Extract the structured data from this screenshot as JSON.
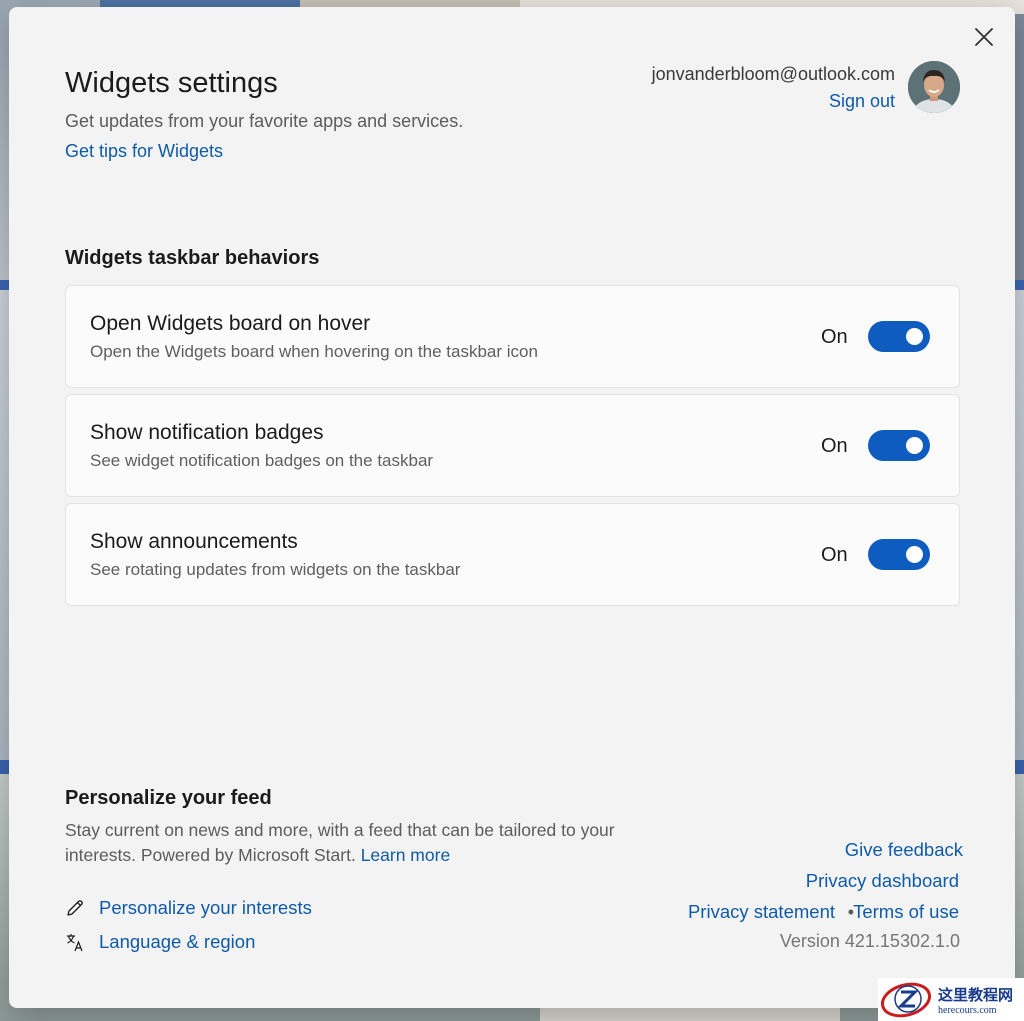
{
  "colors": {
    "accent": "#0e5cc0",
    "link": "#0f5ba8",
    "dialog_bg": "#f3f3f3",
    "card_bg": "#fbfbfb"
  },
  "header": {
    "title": "Widgets settings",
    "subtitle": "Get updates from your favorite apps and services.",
    "tips_link": "Get tips for Widgets",
    "close_icon": "close-icon"
  },
  "account": {
    "email": "jonvanderbloom@outlook.com",
    "sign_out": "Sign out"
  },
  "taskbar": {
    "heading": "Widgets taskbar behaviors",
    "items": [
      {
        "title": "Open Widgets board on hover",
        "description": "Open the Widgets board when hovering on the taskbar icon",
        "state": "On",
        "enabled": true
      },
      {
        "title": "Show notification badges",
        "description": "See widget notification badges on the taskbar",
        "state": "On",
        "enabled": true
      },
      {
        "title": "Show announcements",
        "description": "See rotating updates from widgets on the taskbar",
        "state": "On",
        "enabled": true
      }
    ]
  },
  "feed": {
    "heading": "Personalize your feed",
    "description": "Stay current on news and more, with a feed that can be tailored to your interests. Powered by Microsoft Start.",
    "learn_more": "Learn more",
    "links": [
      {
        "label": "Personalize your interests",
        "icon": "pencil-icon"
      },
      {
        "label": "Language & region",
        "icon": "language-icon"
      }
    ]
  },
  "footer": {
    "give_feedback": "Give feedback",
    "privacy_dashboard": "Privacy dashboard",
    "privacy_statement": "Privacy statement",
    "separator": "•",
    "terms_of_use": "Terms of use",
    "version": "Version 421.15302.1.0"
  },
  "watermark": {
    "chinese": "这里教程网",
    "url": "herecours.com"
  }
}
